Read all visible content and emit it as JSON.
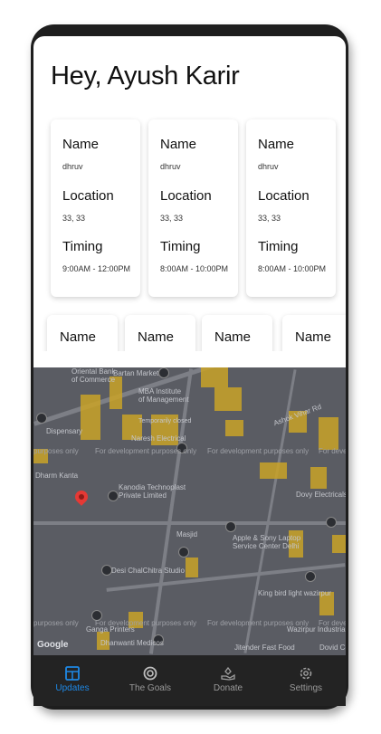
{
  "header": {
    "greeting": "Hey, Ayush Karir"
  },
  "cards": [
    {
      "name_label": "Name",
      "name": "dhruv",
      "location_label": "Location",
      "location": "33, 33",
      "timing_label": "Timing",
      "timing": "9:00AM - 12:00PM"
    },
    {
      "name_label": "Name",
      "name": "dhruv",
      "location_label": "Location",
      "location": "33, 33",
      "timing_label": "Timing",
      "timing": "8:00AM - 10:00PM"
    },
    {
      "name_label": "Name",
      "name": "dhruv",
      "location_label": "Location",
      "location": "33, 33",
      "timing_label": "Timing",
      "timing": "8:00AM - 10:00PM"
    }
  ],
  "cards_row2": [
    {
      "name_label": "Name"
    },
    {
      "name_label": "Name"
    },
    {
      "name_label": "Name"
    },
    {
      "name_label": "Name"
    }
  ],
  "map": {
    "dev_watermark": "For development purposes only",
    "dev_watermark_edge_left": "purposes only",
    "dev_watermark_edge_right": "For devel",
    "labels": {
      "oriental_bank": "Oriental Bank\nof Commerce",
      "bartan_market": "Bartan Market",
      "mba_institute": "MBA Institute\nof Management",
      "temporarily_closed": "Temporarily closed",
      "naresh_electrical": "Naresh Electrical",
      "dispensary": "Dispensary",
      "dharm_kanta": "Dharm Kanta",
      "kanodia": "Kanodia Technoplast\nPrivate Limited",
      "ashok_vihar": "Ashok Vihar Rd",
      "dovy_electricals": "Dovy Electricals",
      "masjid": "Masjid",
      "apple_sony": "Apple & Sony Laptop\nService Center Delhi",
      "desi_chal_chitra": "Desi ChalChitra Studio",
      "kingbird": "King bird light wazirpur",
      "ganga_printers": "Ganga Printers",
      "dhanwanti": "Dhanwanti Medicos",
      "wazirpur_industrial": "Wazirpur Industrial",
      "jitender_fast_food": "Jitender Fast Food",
      "dovid_cell": "Dovid Cell"
    },
    "google_logo": "Google"
  },
  "nav": {
    "items": [
      {
        "label": "Updates",
        "icon": "updates-icon",
        "active": true
      },
      {
        "label": "The Goals",
        "icon": "goals-icon",
        "active": false
      },
      {
        "label": "Donate",
        "icon": "donate-icon",
        "active": false
      },
      {
        "label": "Settings",
        "icon": "settings-icon",
        "active": false
      }
    ]
  },
  "colors": {
    "accent": "#1e88e5",
    "nav_bg": "#232323",
    "map_bg": "#5a5c63",
    "map_block": "#c9a227",
    "pin": "#e53935"
  }
}
